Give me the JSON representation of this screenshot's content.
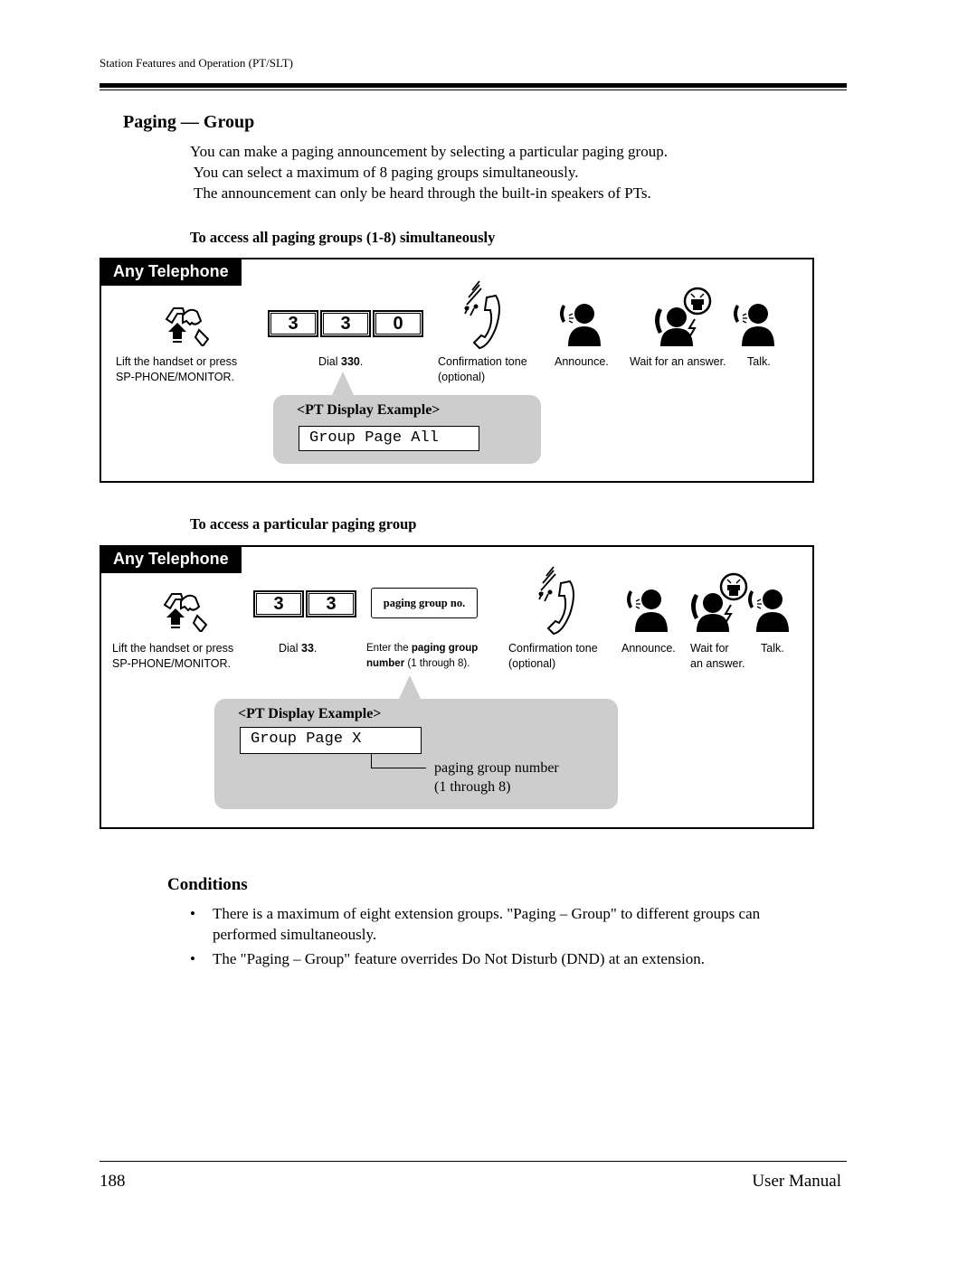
{
  "header": {
    "running_head": "Station Features and Operation (PT/SLT)"
  },
  "section": {
    "title": "Paging — Group",
    "intro": [
      "You can make a paging announcement by selecting a particular paging group.",
      " You can select a maximum of 8 paging groups simultaneously.",
      " The announcement can only be heard through the built-in speakers of PTs."
    ]
  },
  "procedure_all": {
    "heading": "To access all paging groups (1-8) simultaneously",
    "tab": "Any Telephone",
    "keys": [
      "3",
      "3",
      "0"
    ],
    "steps": {
      "lift": [
        "Lift the handset or press",
        "SP-PHONE/MONITOR."
      ],
      "dial_prefix": "Dial ",
      "dial_code": "330",
      "dial_suffix": ".",
      "confirm": [
        "Confirmation tone",
        "(optional)"
      ],
      "announce": "Announce.",
      "wait": "Wait for an answer.",
      "talk": "Talk."
    },
    "display": {
      "title": "<PT Display Example>",
      "lcd": "Group Page All"
    },
    "icons": [
      "lift-handset-icon",
      "confirmation-tone-icon",
      "announce-icon",
      "wait-answer-icon",
      "talk-icon"
    ]
  },
  "procedure_group": {
    "heading": "To access a particular paging group",
    "tab": "Any Telephone",
    "keys": [
      "3",
      "3"
    ],
    "input_box": "paging group no.",
    "steps": {
      "lift": [
        "Lift the handset or press",
        "SP-PHONE/MONITOR."
      ],
      "dial_prefix": "Dial ",
      "dial_code": "33",
      "dial_suffix": ".",
      "enter_prefix": "Enter the ",
      "enter_bold1": "paging group",
      "enter_bold2": "number",
      "enter_suffix": " (1 through 8).",
      "confirm": [
        "Confirmation tone",
        "(optional)"
      ],
      "announce": "Announce.",
      "wait": [
        "Wait for",
        "an answer."
      ],
      "talk": "Talk."
    },
    "display": {
      "title": "<PT Display Example>",
      "lcd": "Group Page X",
      "callout": [
        "paging group number",
        "(1 through 8)"
      ]
    }
  },
  "conditions": {
    "title": "Conditions",
    "bullet": "•",
    "items": [
      [
        "There is a maximum of eight extension groups. \"Paging – Group\" to different groups can",
        "performed simultaneously."
      ],
      [
        "The \"Paging – Group\" feature overrides Do Not Disturb (DND) at an extension."
      ]
    ]
  },
  "footer": {
    "page_number": "188",
    "manual": "User Manual"
  }
}
